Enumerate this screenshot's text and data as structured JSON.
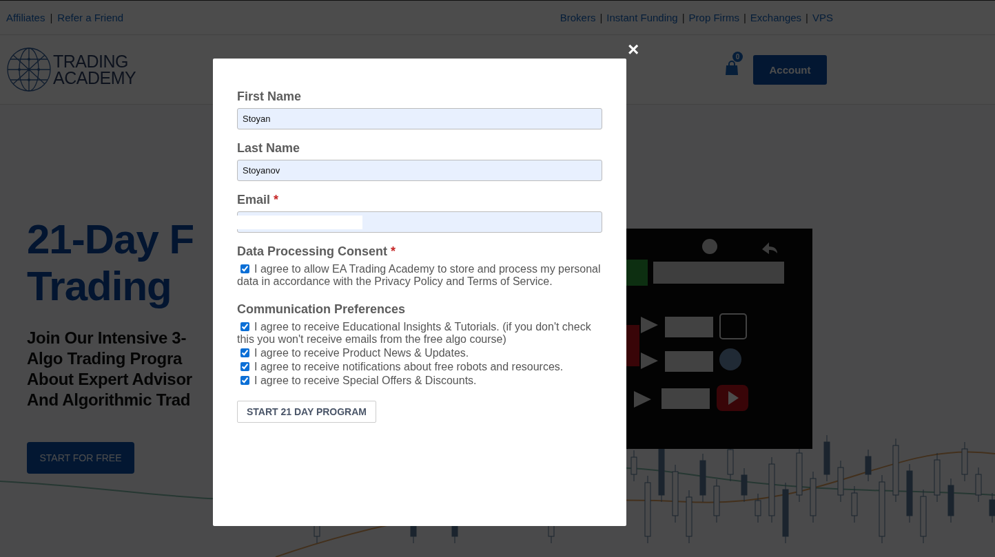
{
  "top_bar": {
    "left": [
      {
        "kind": "link",
        "text": "Affiliates"
      },
      {
        "kind": "separator",
        "text": "|"
      },
      {
        "kind": "link",
        "text": "Refer a Friend"
      }
    ],
    "right": [
      {
        "kind": "link",
        "text": "Brokers"
      },
      {
        "kind": "separator",
        "text": "|"
      },
      {
        "kind": "link",
        "text": "Instant Funding"
      },
      {
        "kind": "separator",
        "text": "|"
      },
      {
        "kind": "link",
        "text": "Prop Firms"
      },
      {
        "kind": "separator",
        "text": "|"
      },
      {
        "kind": "link",
        "text": "Exchanges"
      },
      {
        "kind": "separator",
        "text": "|"
      },
      {
        "kind": "link",
        "text": "VPS"
      }
    ]
  },
  "header": {
    "logo_lines": [
      "TRADING",
      "ACADEMY"
    ],
    "cart_count": "0",
    "account_button": "Account"
  },
  "hero": {
    "title_lines": [
      "21-Day F",
      "Trading"
    ],
    "subtitle_lines": [
      "Join Our Intensive 3-",
      "Algo Trading Progra",
      "About Expert Advisor",
      "And Algorithmic Trad"
    ],
    "button": "START FOR FREE",
    "video": {
      "kind": "picture"
    }
  },
  "modal": {
    "close": "×",
    "fields": [
      {
        "label": "First Name",
        "value": "Stoyan"
      },
      {
        "label": "Last Name",
        "value": "Stoyanov"
      },
      {
        "label": "Email",
        "required_mark": "*",
        "redacted": true
      }
    ],
    "sections": [
      {
        "title": "Data Processing Consent",
        "required_mark": "*",
        "options": [
          {
            "label": "I agree to allow EA Trading Academy to store and process my personal data in accordance with the Privacy Policy and Terms of Service.",
            "checked": true
          }
        ]
      },
      {
        "title": "Communication Preferences",
        "options": [
          {
            "label": "I agree to receive Educational Insights & Tutorials. (if you don't check this you won't receive emails from the free algo course)",
            "checked": true
          },
          {
            "label": "I agree to receive Product News & Updates.",
            "checked": true
          },
          {
            "label": "I agree to receive notifications about free robots and resources.",
            "checked": true
          },
          {
            "label": "I agree to receive Special Offers & Discounts.",
            "checked": true
          }
        ]
      }
    ],
    "submit": "START 21 DAY PROGRAM"
  }
}
